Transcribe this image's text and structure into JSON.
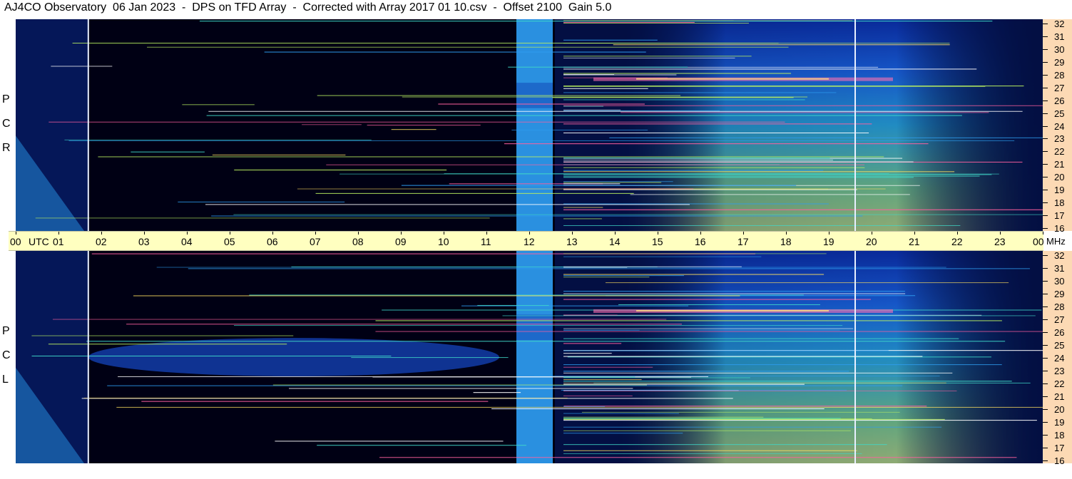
{
  "title": "AJ4CO Observatory  06 Jan 2023  -  DPS on TFD Array  -  Corrected with Array 2017 01 10.csv  -  Offset 2100  Gain 5.0",
  "panels": [
    {
      "id": "rcp",
      "side_label": [
        "P",
        "C",
        "R"
      ]
    },
    {
      "id": "lcp",
      "side_label": [
        "P",
        "C",
        "L"
      ]
    }
  ],
  "time_axis": {
    "labels": [
      "00",
      "01",
      "02",
      "03",
      "04",
      "05",
      "06",
      "07",
      "08",
      "09",
      "10",
      "11",
      "12",
      "13",
      "14",
      "15",
      "16",
      "17",
      "18",
      "19",
      "20",
      "21",
      "22",
      "23",
      "00"
    ],
    "unit_label": "UTC",
    "freq_unit": "MHz"
  },
  "freq_axis": {
    "labels": [
      "32",
      "31",
      "30",
      "29",
      "28",
      "27",
      "26",
      "25",
      "24",
      "23",
      "22",
      "21",
      "20",
      "19",
      "18",
      "17",
      "16"
    ]
  },
  "chart_data": {
    "type": "heatmap",
    "title": "AJ4CO Observatory  06 Jan 2023  -  DPS on TFD Array  -  Corrected with Array 2017 01 10.csv  -  Offset 2100  Gain 5.0",
    "xlabel": "UTC",
    "ylabel": "MHz",
    "xlim": [
      0,
      24
    ],
    "ylim": [
      16,
      32
    ],
    "series": [
      {
        "name": "RCP",
        "values": []
      },
      {
        "name": "LCP",
        "values": []
      }
    ],
    "colormap": [
      "#000018",
      "#0a1a80",
      "#1e50e6",
      "#2e9ef0",
      "#40d8c8",
      "#b8ee60",
      "#ffe060",
      "#ff60a0",
      "#ffffff"
    ]
  }
}
